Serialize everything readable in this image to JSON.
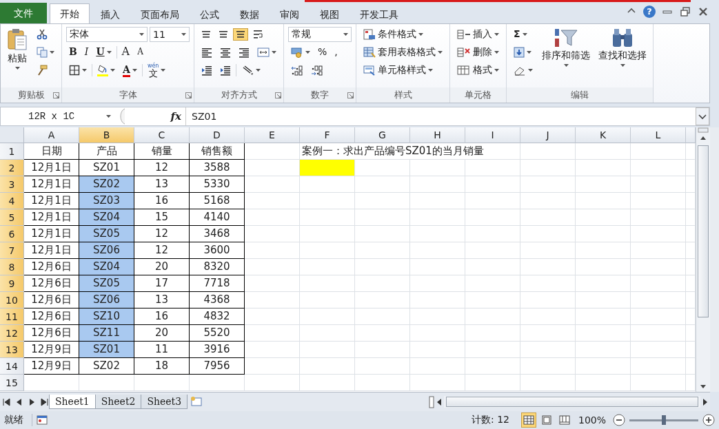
{
  "tabs": [
    {
      "label": "文件",
      "kind": "file",
      "selected": false
    },
    {
      "label": "开始",
      "kind": "tab",
      "selected": true
    },
    {
      "label": "插入",
      "kind": "tab",
      "selected": false
    },
    {
      "label": "页面布局",
      "kind": "tab",
      "selected": false
    },
    {
      "label": "公式",
      "kind": "tab",
      "selected": false
    },
    {
      "label": "数据",
      "kind": "tab",
      "selected": false
    },
    {
      "label": "审阅",
      "kind": "tab",
      "selected": false
    },
    {
      "label": "视图",
      "kind": "tab",
      "selected": false
    },
    {
      "label": "开发工具",
      "kind": "tab",
      "selected": false
    }
  ],
  "window_controls": [
    {
      "kind": "collapse"
    },
    {
      "kind": "help",
      "glyph": "?"
    },
    {
      "kind": "minimize"
    },
    {
      "kind": "restore"
    },
    {
      "kind": "close"
    }
  ],
  "ribbon": {
    "groups": [
      {
        "label": "剪贴板",
        "launcher": true,
        "columns": [
          [
            [
              {
                "kind": "paste",
                "label": "粘贴",
                "dropdown": true
              }
            ]
          ],
          [
            [
              {
                "kind": "cut",
                "dropdown": false
              }
            ],
            [
              {
                "kind": "copy",
                "dropdown": true
              }
            ],
            [
              {
                "kind": "painter",
                "dropdown": false
              }
            ]
          ]
        ]
      },
      {
        "label": "字体",
        "launcher": true,
        "columns": [
          [
            [
              {
                "kind": "font-combo",
                "value": "宋体"
              },
              {
                "kind": "size-combo",
                "value": "11"
              }
            ],
            [
              {
                "kind": "bold",
                "glyph": "B",
                "dropdown": false
              },
              {
                "kind": "italic",
                "glyph": "I",
                "dropdown": false
              },
              {
                "kind": "underline",
                "glyph": "U",
                "dropdown": true
              },
              {
                "kind": "sep"
              },
              {
                "kind": "grow-font",
                "glyph": "A",
                "dropdown": false
              },
              {
                "kind": "shrink-font",
                "glyph": "A",
                "dropdown": false
              }
            ],
            [
              {
                "kind": "borders",
                "dropdown": true
              },
              {
                "kind": "sep"
              },
              {
                "kind": "fill-color",
                "color": "#ffff00",
                "dropdown": true
              },
              {
                "kind": "font-color",
                "glyph": "A",
                "color": "#e00000",
                "dropdown": true
              },
              {
                "kind": "sep"
              },
              {
                "kind": "phonetic",
                "glyph": "文",
                "annotation": "wén",
                "dropdown": true
              }
            ]
          ]
        ]
      },
      {
        "label": "对齐方式",
        "launcher": true,
        "columns": [
          [
            [
              {
                "kind": "align-top",
                "selected": false,
                "dropdown": false
              },
              {
                "kind": "align-middle",
                "selected": false,
                "dropdown": false
              },
              {
                "kind": "align-bottom",
                "selected": true,
                "dropdown": false
              },
              {
                "kind": "wrap",
                "selected": false,
                "dropdown": false
              }
            ],
            [
              {
                "kind": "align-left",
                "dropdown": false
              },
              {
                "kind": "align-center",
                "dropdown": false
              },
              {
                "kind": "align-right",
                "dropdown": false
              },
              {
                "kind": "merge",
                "dropdown": true
              }
            ],
            [
              {
                "kind": "outdent",
                "dropdown": false
              },
              {
                "kind": "indent",
                "dropdown": false
              },
              {
                "kind": "sep"
              },
              {
                "kind": "orientation",
                "dropdown": true
              }
            ]
          ]
        ]
      },
      {
        "label": "数字",
        "launcher": true,
        "columns": [
          [
            [
              {
                "kind": "format-combo",
                "value": "常规"
              }
            ],
            [
              {
                "kind": "accounting",
                "dropdown": true
              },
              {
                "kind": "percent",
                "glyph": "%",
                "dropdown": false
              },
              {
                "kind": "comma",
                "glyph": ",",
                "dropdown": false
              }
            ],
            [
              {
                "kind": "inc-decimal",
                "dropdown": false
              },
              {
                "kind": "dec-decimal",
                "dropdown": false
              }
            ]
          ]
        ]
      },
      {
        "label": "样式",
        "launcher": false,
        "columns": [
          [
            [
              {
                "kind": "cond-format",
                "label": "条件格式",
                "dropdown": true
              }
            ],
            [
              {
                "kind": "table-format",
                "label": "套用表格格式",
                "dropdown": true
              }
            ],
            [
              {
                "kind": "cell-styles",
                "label": "单元格样式",
                "dropdown": true
              }
            ]
          ]
        ]
      },
      {
        "label": "单元格",
        "launcher": false,
        "columns": [
          [
            [
              {
                "kind": "insert-cells",
                "label": "插入",
                "dropdown": true
              }
            ],
            [
              {
                "kind": "delete-cells",
                "label": "删除",
                "dropdown": true
              }
            ],
            [
              {
                "kind": "format-cells",
                "label": "格式",
                "dropdown": true
              }
            ]
          ]
        ]
      },
      {
        "label": "编辑",
        "launcher": false,
        "columns": [
          [
            [
              {
                "kind": "sum",
                "glyph": "Σ",
                "dropdown": true
              }
            ],
            [
              {
                "kind": "fill-down",
                "dropdown": true
              }
            ],
            [
              {
                "kind": "clear",
                "dropdown": true
              }
            ]
          ],
          [
            [
              {
                "kind": "sort-filter",
                "label": "排序和筛选",
                "dropdown": true
              }
            ]
          ],
          [
            [
              {
                "kind": "find",
                "label": "查找和选择",
                "dropdown": true
              }
            ]
          ]
        ]
      }
    ]
  },
  "formula_bar": {
    "name_box": "12R x 1C",
    "function_label": "fx",
    "value": "SZ01"
  },
  "sheet": {
    "columns": [
      {
        "label": "A",
        "selected": false
      },
      {
        "label": "B",
        "selected": true
      },
      {
        "label": "C",
        "selected": false
      },
      {
        "label": "D",
        "selected": false
      },
      {
        "label": "E",
        "selected": false
      },
      {
        "label": "F",
        "selected": false
      },
      {
        "label": "G",
        "selected": false
      },
      {
        "label": "H",
        "selected": false
      },
      {
        "label": "I",
        "selected": false
      },
      {
        "label": "J",
        "selected": false
      },
      {
        "label": "K",
        "selected": false
      },
      {
        "label": "L",
        "selected": false
      }
    ],
    "rows": [
      {
        "label": "1",
        "selected": false,
        "cells": [
          "日期",
          "产品",
          "销量",
          "销售额"
        ],
        "note": "案例一：求出产品编号SZ01的当月销量"
      },
      {
        "label": "2",
        "selected": true,
        "cells": [
          "12月1日",
          "SZ01",
          "12",
          "3588"
        ],
        "color": "#ffff00"
      },
      {
        "label": "3",
        "selected": true,
        "cells": [
          "12月1日",
          "SZ02",
          "13",
          "5330"
        ]
      },
      {
        "label": "4",
        "selected": true,
        "cells": [
          "12月1日",
          "SZ03",
          "16",
          "5168"
        ]
      },
      {
        "label": "5",
        "selected": true,
        "cells": [
          "12月1日",
          "SZ04",
          "15",
          "4140"
        ]
      },
      {
        "label": "6",
        "selected": true,
        "cells": [
          "12月1日",
          "SZ05",
          "12",
          "3468"
        ]
      },
      {
        "label": "7",
        "selected": true,
        "cells": [
          "12月1日",
          "SZ06",
          "12",
          "3600"
        ]
      },
      {
        "label": "8",
        "selected": true,
        "cells": [
          "12月6日",
          "SZ04",
          "20",
          "8320"
        ]
      },
      {
        "label": "9",
        "selected": true,
        "cells": [
          "12月6日",
          "SZ05",
          "17",
          "7718"
        ]
      },
      {
        "label": "10",
        "selected": true,
        "cells": [
          "12月6日",
          "SZ06",
          "13",
          "4368"
        ]
      },
      {
        "label": "11",
        "selected": true,
        "cells": [
          "12月6日",
          "SZ10",
          "16",
          "4832"
        ]
      },
      {
        "label": "12",
        "selected": true,
        "cells": [
          "12月6日",
          "SZ11",
          "20",
          "5520"
        ]
      },
      {
        "label": "13",
        "selected": true,
        "cells": [
          "12月9日",
          "SZ01",
          "11",
          "3916"
        ]
      },
      {
        "label": "14",
        "selected": false,
        "cells": [
          "12月9日",
          "SZ02",
          "18",
          "7956"
        ]
      },
      {
        "label": "15",
        "selected": false
      }
    ]
  },
  "sheet_tabs": [
    {
      "label": "Sheet1",
      "selected": true
    },
    {
      "label": "Sheet2",
      "selected": false
    },
    {
      "label": "Sheet3",
      "selected": false
    }
  ],
  "status_bar": {
    "ready": "就绪",
    "count": "计数: 12",
    "views": [
      {
        "kind": "normal",
        "selected": true
      },
      {
        "kind": "page-layout",
        "selected": false
      },
      {
        "kind": "page-break",
        "selected": false
      }
    ],
    "zoom": "100%",
    "zoom_slider": {
      "level": 0.5
    }
  }
}
